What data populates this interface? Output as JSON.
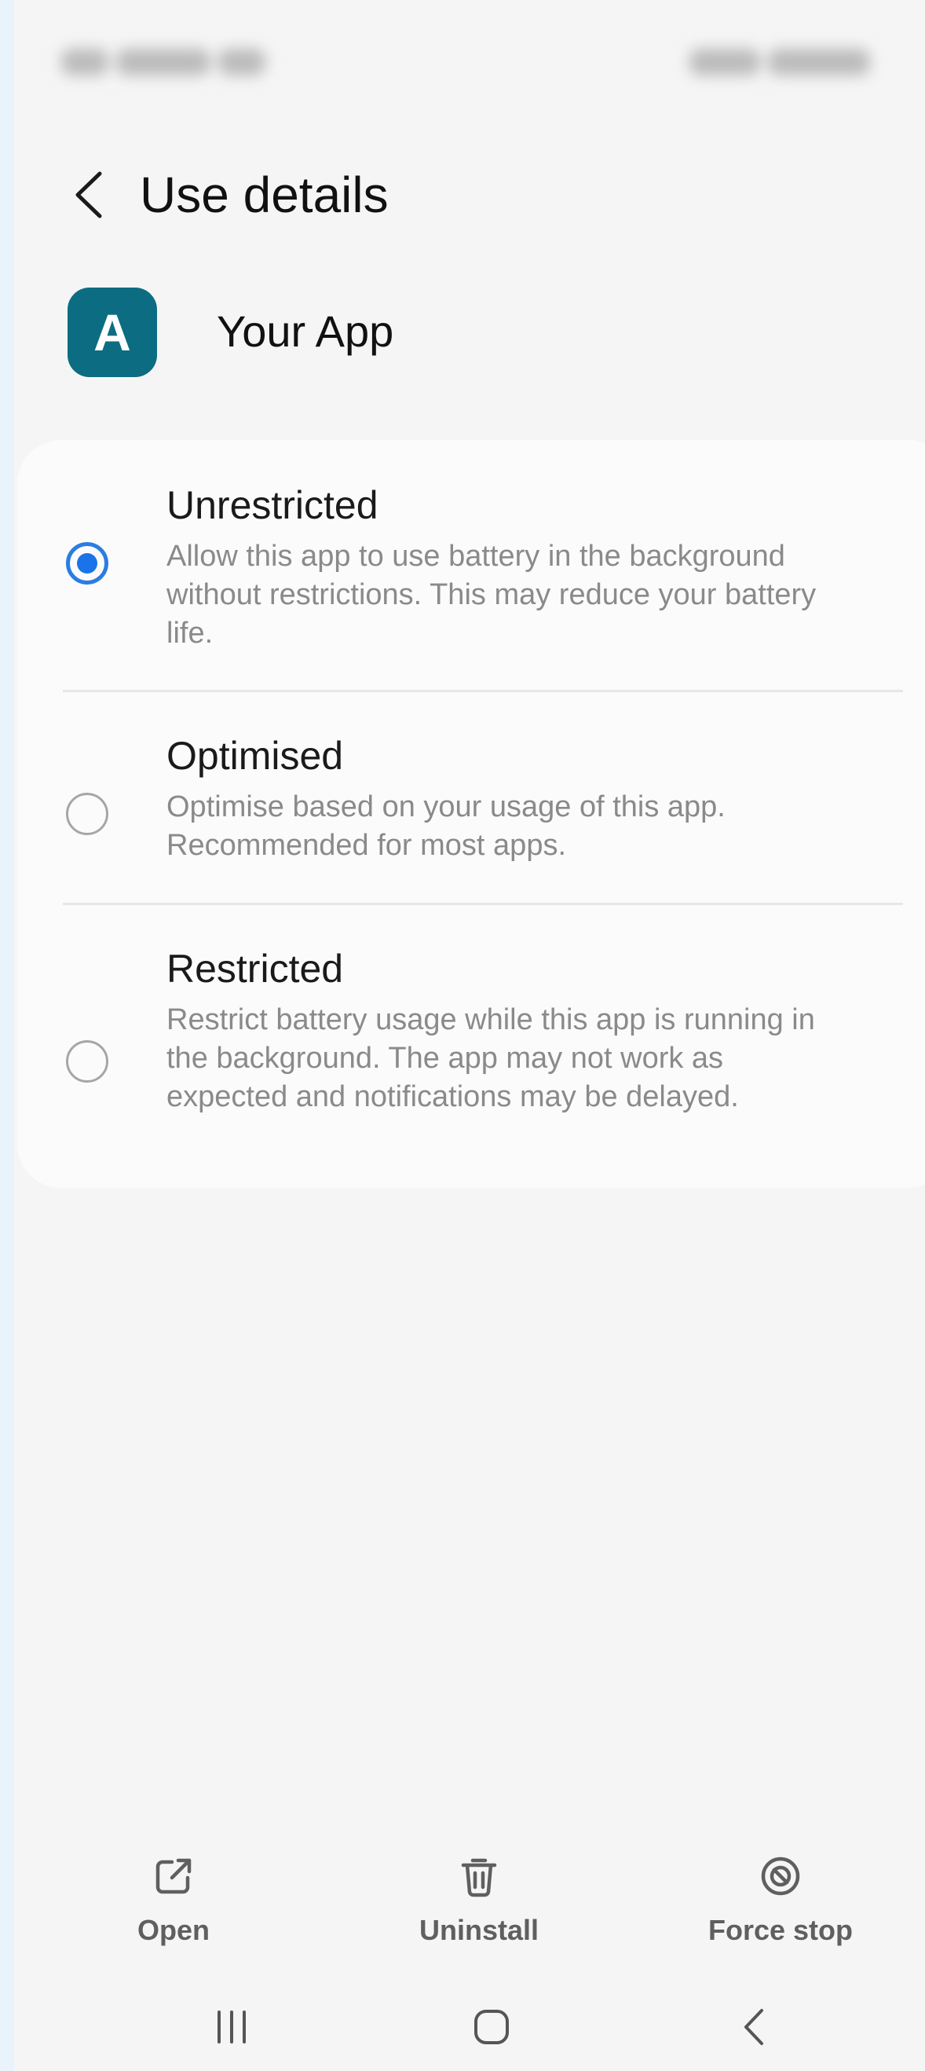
{
  "header": {
    "title": "Use details",
    "back_icon": "chevron-left-icon"
  },
  "app": {
    "icon_letter": "A",
    "icon_color": "#0c6d82",
    "name": "Your App"
  },
  "battery_options": [
    {
      "title": "Unrestricted",
      "description": "Allow this app to use battery in the background without restrictions. This may reduce your battery life.",
      "selected": true
    },
    {
      "title": "Optimised",
      "description": "Optimise based on your usage of this app. Recommended for most apps.",
      "selected": false
    },
    {
      "title": "Restricted",
      "description": "Restrict battery usage while this app is running in the background. The app may not work as expected and notifications may be delayed.",
      "selected": false
    }
  ],
  "actions": [
    {
      "label": "Open",
      "icon": "open-external-icon"
    },
    {
      "label": "Uninstall",
      "icon": "trash-icon"
    },
    {
      "label": "Force stop",
      "icon": "stop-icon"
    }
  ],
  "nav": {
    "recents_icon": "recents-icon",
    "home_icon": "home-icon",
    "back_icon": "back-icon"
  },
  "colors": {
    "accent": "#1a73e8",
    "background": "#f5f5f5",
    "card": "#fbfbfb",
    "action_label": "#5f5f5f"
  }
}
